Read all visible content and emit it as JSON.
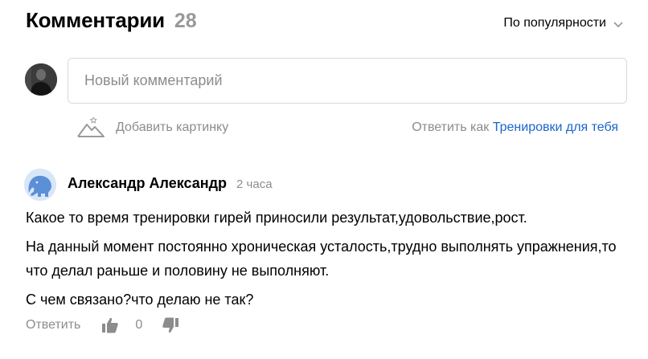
{
  "header": {
    "title": "Комментарии",
    "count": "28",
    "sort_label": "По популярности"
  },
  "compose": {
    "placeholder": "Новый комментарий",
    "add_image_label": "Добавить картинку",
    "reply_as_prefix": "Ответить как",
    "channel_name": "Тренировки для тебя"
  },
  "comment": {
    "author": "Александр Александр",
    "time": "2 часа",
    "paragraphs": [
      "Какое то время тренировки гирей приносили результат,удовольствие,рост.",
      "На данный момент постоянно хроническая усталость,трудно выполнять упражнения,то что делал раньше и половину не выполняют.",
      "С чем связано?что делаю не так?"
    ],
    "reply_label": "Ответить",
    "votes": "0"
  },
  "icons": {
    "sort": "chevron-down-icon",
    "add_image": "mountain-image-icon",
    "like": "thumbs-up-icon",
    "dislike": "thumbs-down-icon"
  },
  "colors": {
    "accent_link": "#1a66cc",
    "muted_text": "#8c8c8c",
    "count_gray": "#999999",
    "avatar_elephant": "#5b8fd6"
  }
}
